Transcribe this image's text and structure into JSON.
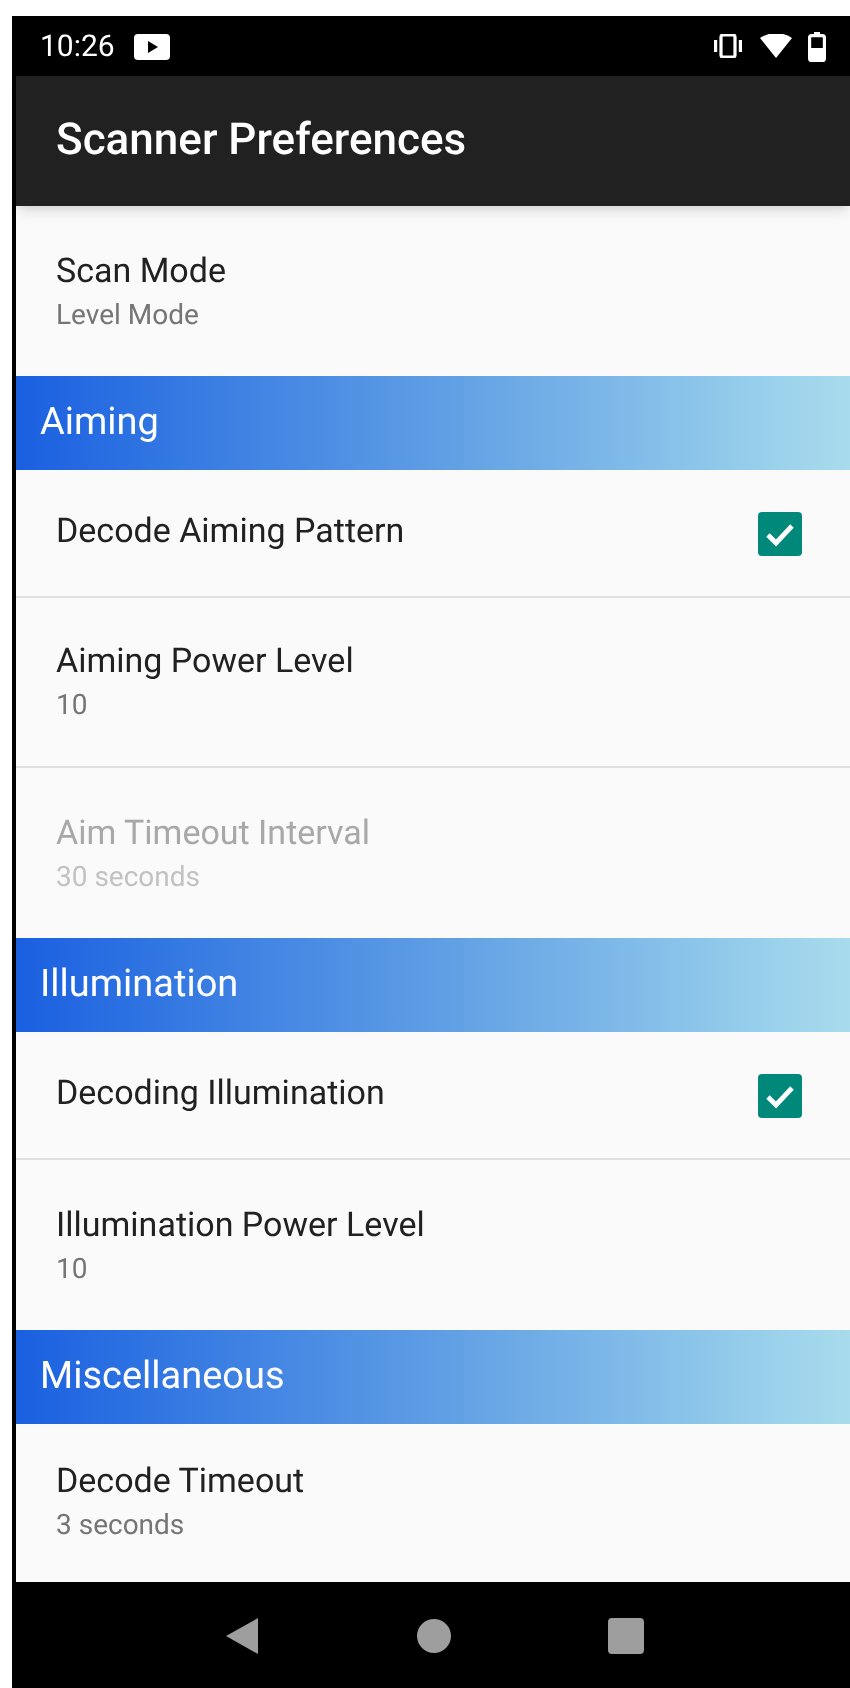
{
  "status_bar": {
    "time": "10:26"
  },
  "toolbar": {
    "title": "Scanner Preferences"
  },
  "preferences": [
    {
      "kind": "item",
      "title": "Scan Mode",
      "summary": "Level Mode",
      "disabled": false
    },
    {
      "kind": "header",
      "title": "Aiming"
    },
    {
      "kind": "checkbox",
      "title": "Decode Aiming Pattern",
      "checked": true,
      "disabled": false
    },
    {
      "kind": "item",
      "title": "Aiming Power Level",
      "summary": "10",
      "disabled": false
    },
    {
      "kind": "item",
      "title": "Aim Timeout Interval",
      "summary": "30 seconds",
      "disabled": true
    },
    {
      "kind": "header",
      "title": "Illumination"
    },
    {
      "kind": "checkbox",
      "title": "Decoding Illumination",
      "checked": true,
      "disabled": false
    },
    {
      "kind": "item",
      "title": "Illumination Power Level",
      "summary": "10",
      "disabled": false
    },
    {
      "kind": "header",
      "title": "Miscellaneous"
    },
    {
      "kind": "item",
      "title": "Decode Timeout",
      "summary": "3 seconds",
      "disabled": false
    }
  ]
}
